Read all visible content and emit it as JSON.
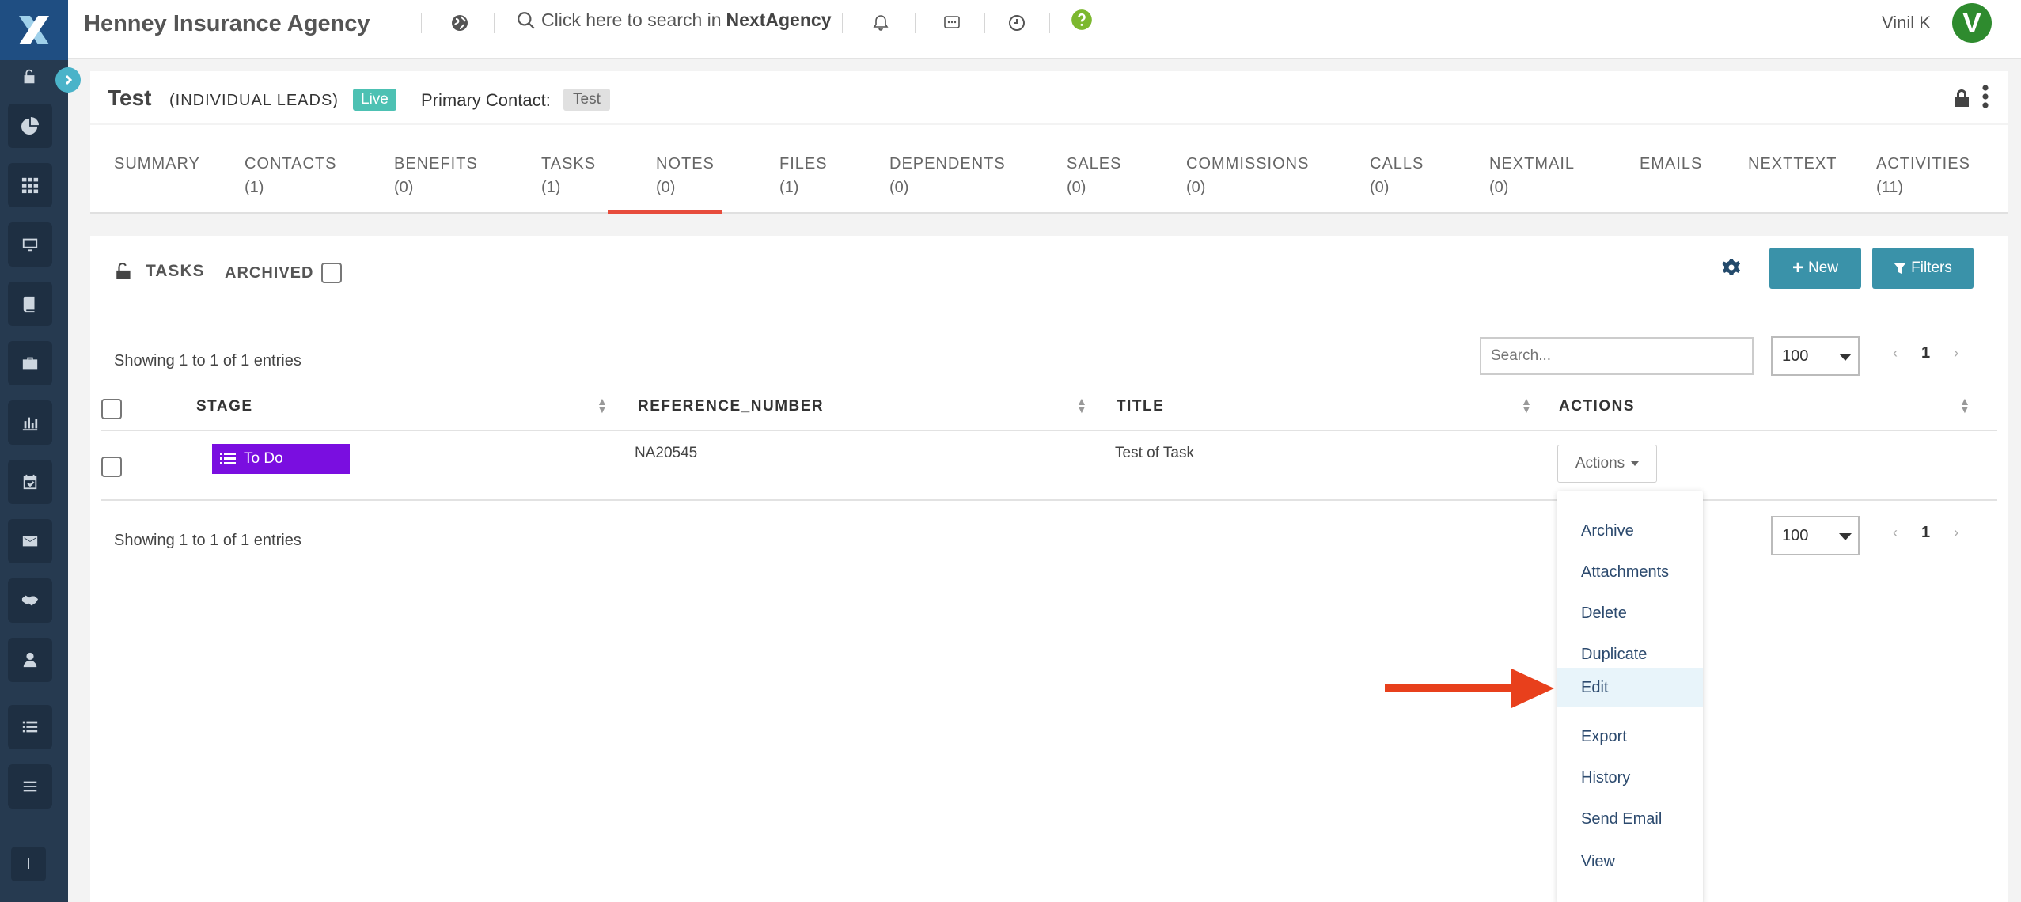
{
  "header": {
    "agency_name": "Henney Insurance Agency",
    "search_prompt": "Click here to search in",
    "search_brand": "NextAgency",
    "user_name": "Vinil K",
    "avatar_initial": "V"
  },
  "sidebar": {
    "items": [
      "unlock-icon",
      "pie-chart-icon",
      "grid-icon",
      "monitor-icon",
      "book-icon",
      "briefcase-icon",
      "bar-chart-icon",
      "calendar-check-icon",
      "envelope-icon",
      "handshake-icon",
      "user-icon",
      "list-icon",
      "menu-icon"
    ],
    "bottom_label": "I"
  },
  "record": {
    "title": "Test",
    "type": "(INDIVIDUAL LEADS)",
    "status": "Live",
    "primary_contact_label": "Primary Contact:",
    "primary_contact_value": "Test"
  },
  "tabs": [
    {
      "label": "SUMMARY",
      "count": ""
    },
    {
      "label": "CONTACTS",
      "count": "(1)"
    },
    {
      "label": "BENEFITS",
      "count": "(0)"
    },
    {
      "label": "TASKS",
      "count": "(1)"
    },
    {
      "label": "NOTES",
      "count": "(0)"
    },
    {
      "label": "FILES",
      "count": "(1)"
    },
    {
      "label": "DEPENDENTS",
      "count": "(0)"
    },
    {
      "label": "SALES",
      "count": "(0)"
    },
    {
      "label": "COMMISSIONS",
      "count": "(0)"
    },
    {
      "label": "CALLS",
      "count": "(0)"
    },
    {
      "label": "NEXTMAIL",
      "count": "(0)"
    },
    {
      "label": "EMAILS",
      "count": ""
    },
    {
      "label": "NEXTTEXT",
      "count": ""
    },
    {
      "label": "ACTIVITIES",
      "count": "(11)"
    }
  ],
  "active_tab": "TASKS",
  "tasks": {
    "heading": "TASKS",
    "archived_label": "ARCHIVED",
    "new_button": "New",
    "filters_button": "Filters",
    "showing_top": "Showing 1 to 1 of 1 entries",
    "showing_bottom": "Showing 1 to 1 of 1 entries",
    "search_placeholder": "Search...",
    "page_size": "100",
    "page_number": "1",
    "columns": [
      "STAGE",
      "REFERENCE_NUMBER",
      "TITLE",
      "ACTIONS"
    ],
    "rows": [
      {
        "stage": "To Do",
        "reference_number": "NA20545",
        "title": "Test of Task",
        "actions_label": "Actions"
      }
    ],
    "stage_color": "#7a0ee0"
  },
  "actions_menu": {
    "items": [
      "Archive",
      "Attachments",
      "Delete",
      "Duplicate",
      "Edit",
      "Export",
      "History",
      "Send Email",
      "View"
    ],
    "highlighted": "Edit"
  },
  "colors": {
    "sidebar": "#263a50",
    "accent_teal": "#3a92a9",
    "live_badge": "#4dc1b3",
    "active_tab_underline": "#e74c3c",
    "annotation_arrow": "#e8401c"
  }
}
